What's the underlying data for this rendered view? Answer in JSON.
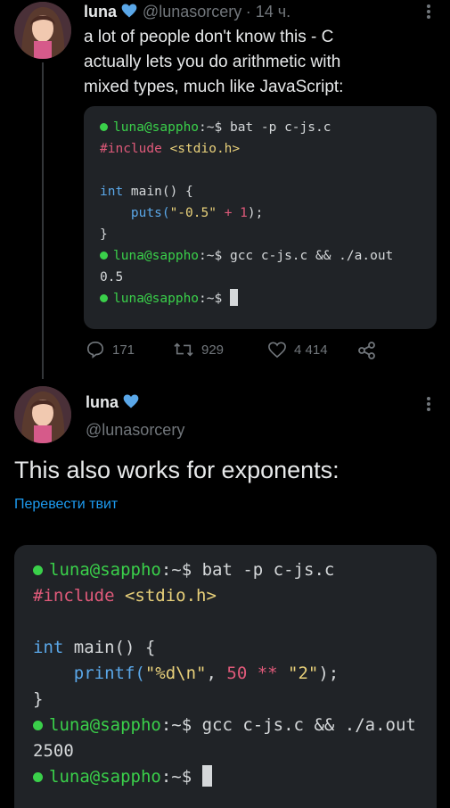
{
  "tweet1": {
    "author_name": "luna",
    "handle": "@lunasorcery",
    "time": "· 14 ч.",
    "text_lines": [
      "a lot of people don't know this - C",
      "actually lets you do arithmetic with",
      "mixed types, much like JavaScript:"
    ],
    "terminal": {
      "prompt_user": "luna@sappho",
      "prompt_path": ":~$",
      "cmd1": " bat -p c-js.c",
      "include_kw": "#include",
      "include_hdr": " <stdio.h>",
      "line_int": "int",
      "line_main": " main() {",
      "puts_fn": "    puts(",
      "puts_str": "\"-0.5\"",
      "puts_plus": " + ",
      "puts_num": "1",
      "puts_end": ");",
      "close_brace": "}",
      "cmd2": " gcc c-js.c && ./a.out",
      "output": "0.5"
    },
    "actions": {
      "replies": "171",
      "retweets": "929",
      "likes": "4 414"
    }
  },
  "tweet2": {
    "author_name": "luna",
    "handle": "@lunasorcery",
    "text": "This also works for exponents:",
    "translate": "Перевести твит",
    "terminal": {
      "prompt_user": "luna@sappho",
      "prompt_path": ":~$",
      "cmd1": " bat -p c-js.c",
      "include_kw": "#include",
      "include_hdr": " <stdio.h>",
      "line_int": "int",
      "line_main": " main() {",
      "printf_fn": "    printf(",
      "printf_fmt": "\"%d\\n\"",
      "printf_comma": ", ",
      "printf_num": "50",
      "printf_op": " ** ",
      "printf_str": "\"2\"",
      "printf_end": ");",
      "close_brace": "}",
      "cmd2": " gcc c-js.c && ./a.out",
      "output": "2500"
    }
  },
  "colors": {
    "background": "#000000",
    "terminal_bg": "#202327",
    "prompt_green": "#3ad04a",
    "keyword_pink": "#e05a7a",
    "type_blue": "#5aa7e8",
    "string_yellow": "#e8d07a",
    "link_blue": "#1d9bf0",
    "verified_blue": "#1d9bf0"
  },
  "icons": {
    "verified": "verified-heart-icon",
    "more": "more-vertical-icon",
    "reply": "reply-icon",
    "retweet": "retweet-icon",
    "like": "like-icon",
    "share": "share-icon"
  }
}
